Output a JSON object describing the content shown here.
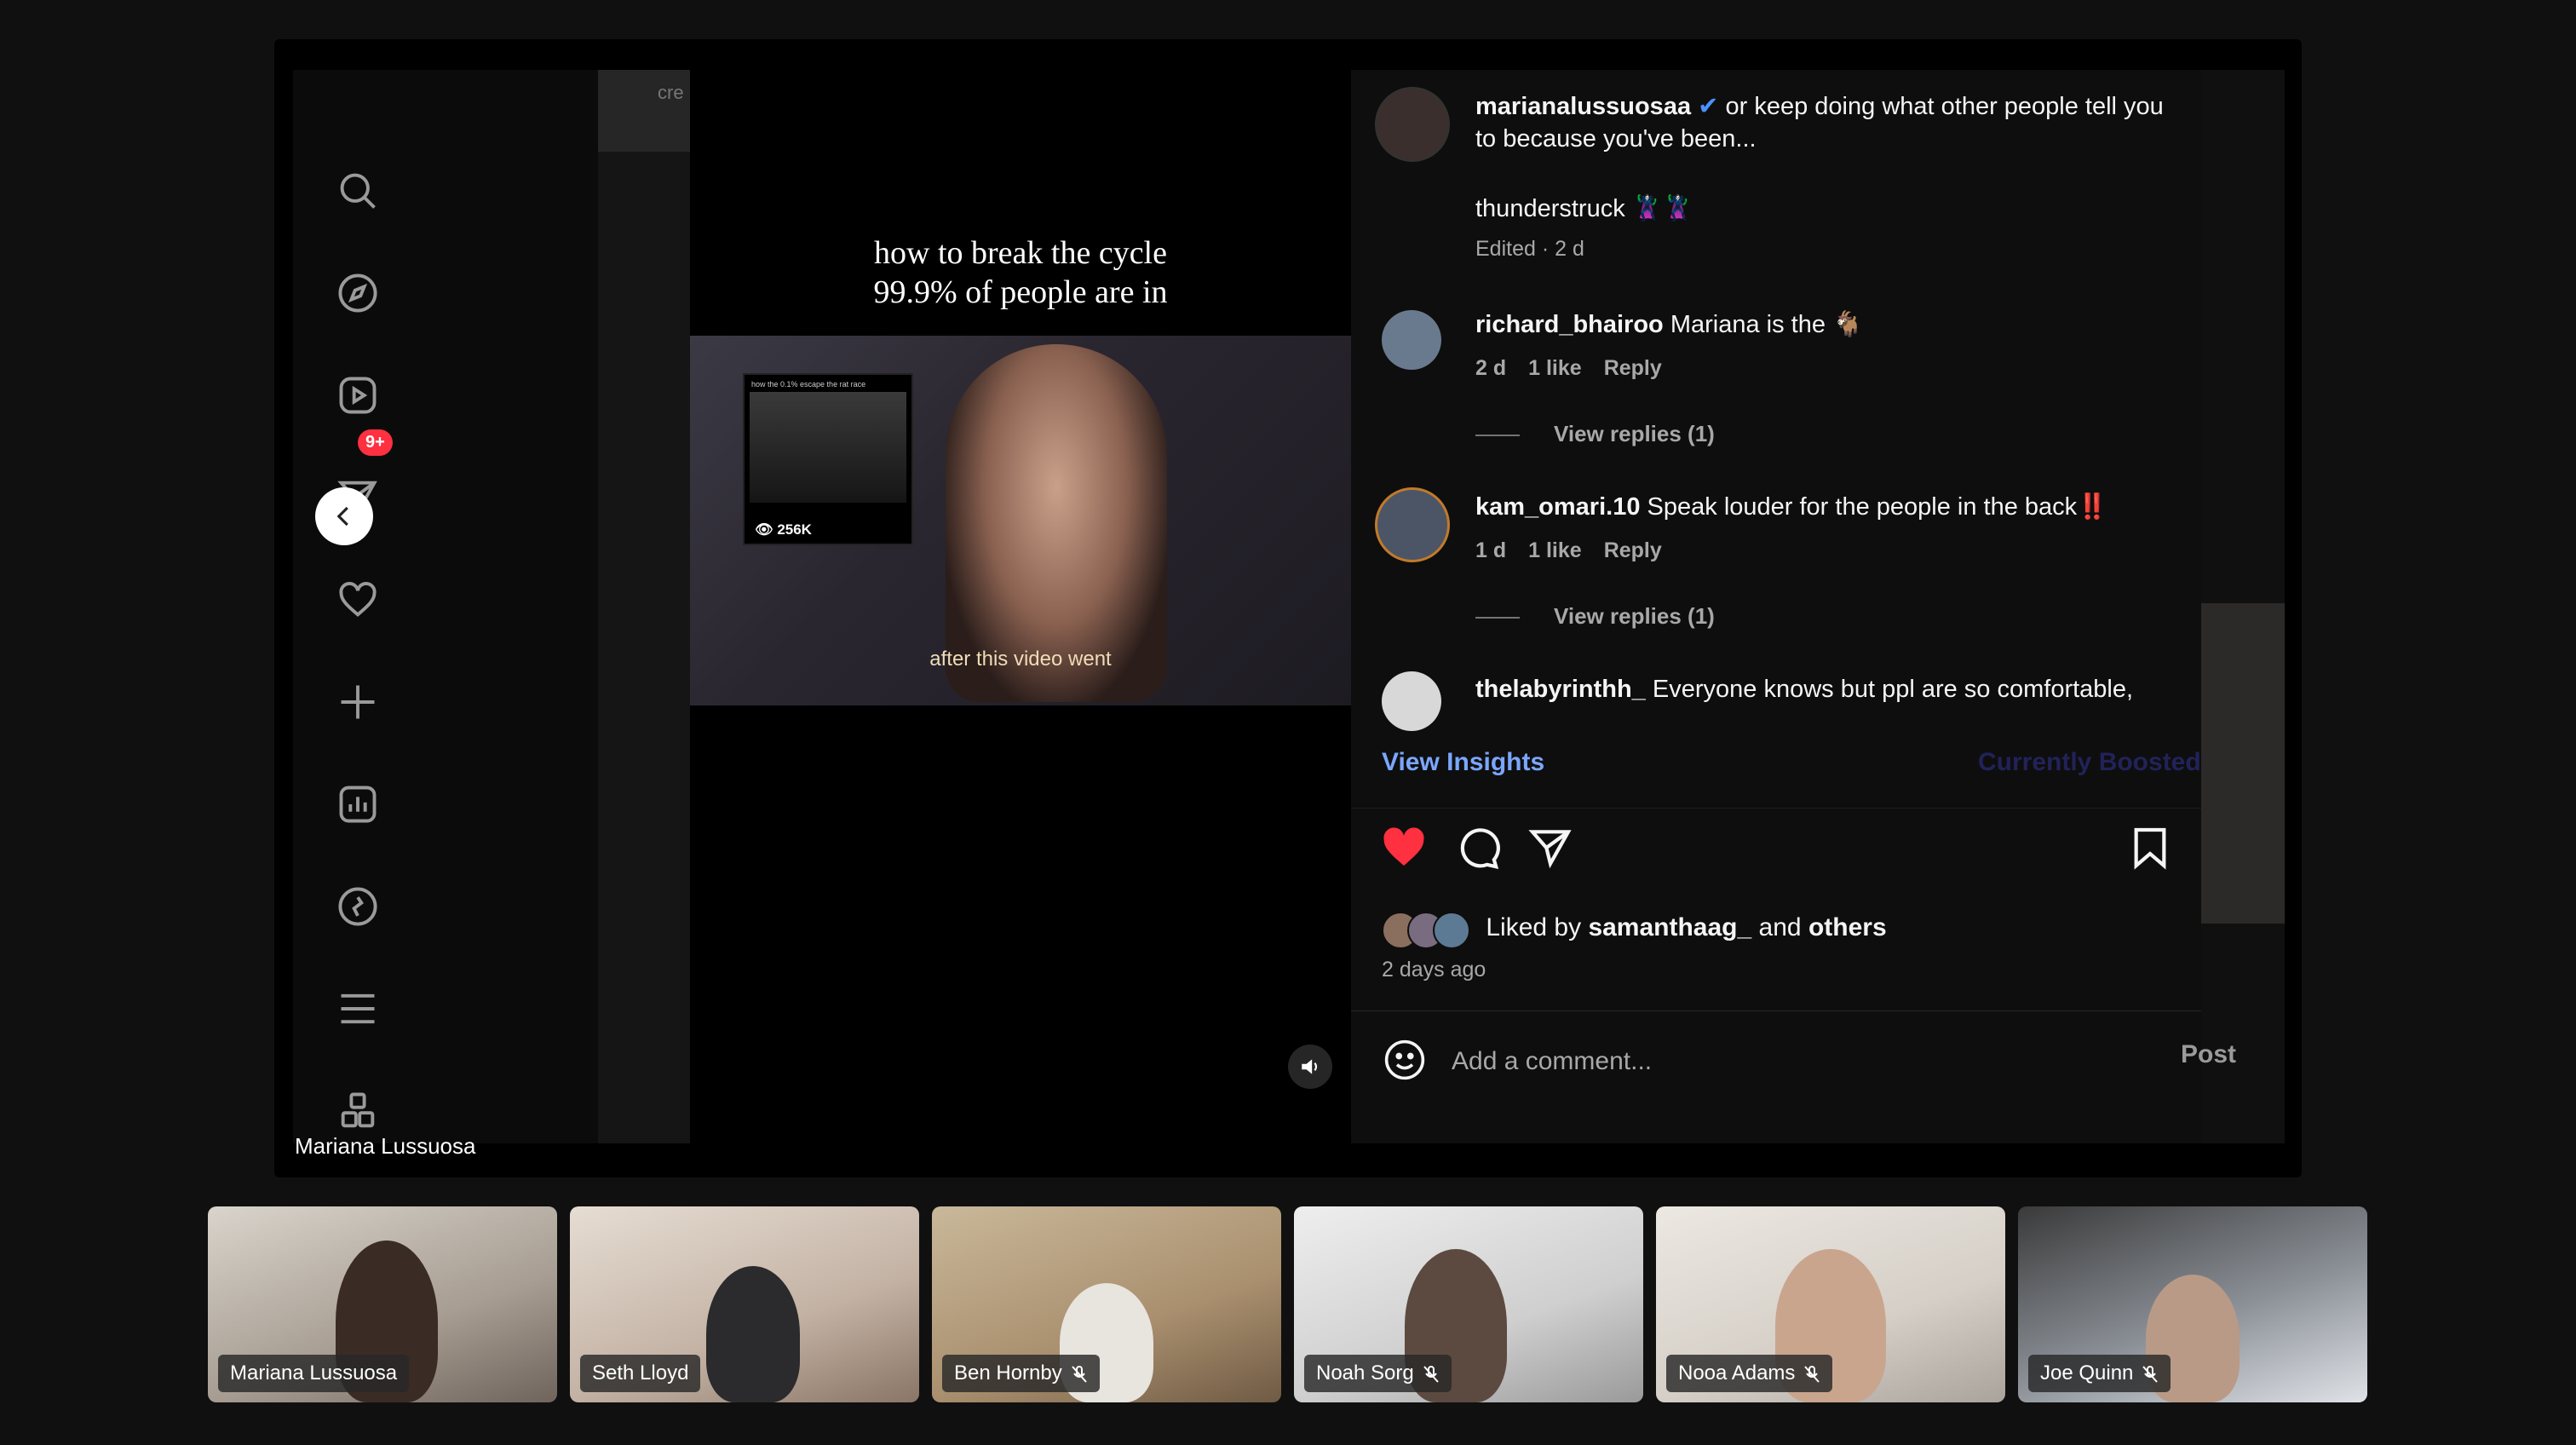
{
  "sidebar": {
    "icons": [
      "search-icon",
      "explore-compass-icon",
      "reels-icon",
      "messages-send-icon",
      "notifications-heart-icon",
      "create-plus-icon",
      "insights-chart-icon",
      "threads-icon",
      "menu-icon",
      "more-apps-icon"
    ],
    "notification_badge": "9+"
  },
  "video": {
    "caption_line1": "how to break the cycle",
    "caption_line2": "99.9% of people are in",
    "inner_thumb_title": "how the 0.1% escape the rat race",
    "inner_views": "256K",
    "subtitle": "after this video went",
    "bg_text": "cre"
  },
  "post": {
    "author": "marianalussuosaa",
    "caption": "or keep doing what other people tell you to because you've been...",
    "caption_extra": "thunderstruck 🦹‍♀️🦹‍♀️",
    "caption_meta": "Edited · 2 d"
  },
  "comments": [
    {
      "user": "richard_bhairoo",
      "text": "Mariana is the 🐐",
      "time": "2 d",
      "likes": "1 like",
      "reply": "Reply",
      "view_replies": "View replies (1)",
      "liked": true
    },
    {
      "user": "kam_omari.10",
      "text": "Speak louder for the people in the back‼️",
      "time": "1 d",
      "likes": "1 like",
      "reply": "Reply",
      "view_replies": "View replies (1)",
      "liked": true
    },
    {
      "user": "thelabyrinthh_",
      "text": "Everyone knows but ppl are so comfortable,",
      "liked": false
    }
  ],
  "insights": {
    "link": "View Insights",
    "boosted": "Currently Boosted"
  },
  "likes_row": {
    "prefix": "Liked by",
    "user": "samanthaag_",
    "and": "and",
    "others": "others"
  },
  "posted_ago": "2 days ago",
  "comment_box": {
    "placeholder": "Add a comment...",
    "post_label": "Post"
  },
  "presenter": "Mariana Lussuosa",
  "participants": [
    {
      "name": "Mariana Lussuosa",
      "muted": false
    },
    {
      "name": "Seth Lloyd",
      "muted": false
    },
    {
      "name": "Ben Hornby",
      "muted": true
    },
    {
      "name": "Noah Sorg",
      "muted": true
    },
    {
      "name": "Nooa Adams",
      "muted": true
    },
    {
      "name": "Joe Quinn",
      "muted": true
    }
  ],
  "colors": {
    "heart": "#ff3040",
    "link": "#7ba6ff",
    "background": "#101010"
  }
}
